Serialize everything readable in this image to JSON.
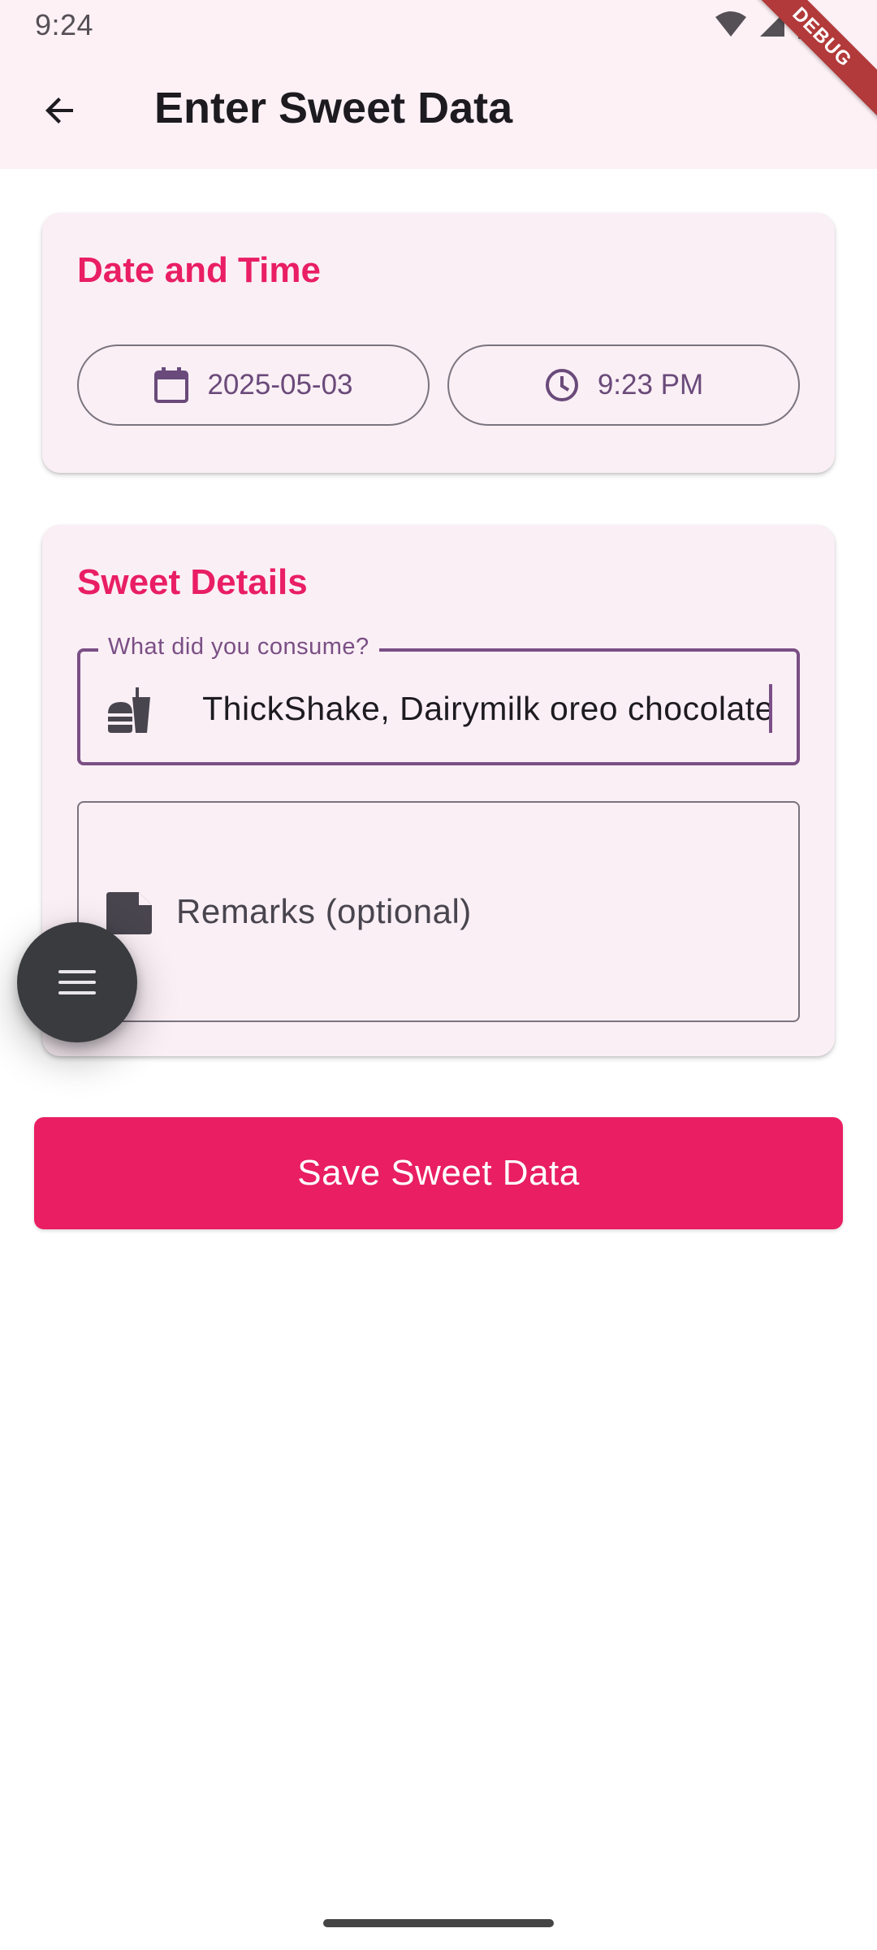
{
  "status_bar": {
    "time": "9:24",
    "icons": [
      "wifi-icon",
      "signal-icon",
      "battery-icon"
    ],
    "debug_banner": "DEBUG"
  },
  "app_bar": {
    "title": "Enter Sweet Data",
    "back_icon": "arrow-back-icon"
  },
  "date_time_card": {
    "title": "Date and Time",
    "date_value": "2025-05-03",
    "date_icon": "calendar-icon",
    "time_value": "9:23 PM",
    "time_icon": "clock-icon"
  },
  "sweet_details_card": {
    "title": "Sweet Details",
    "consume_field": {
      "label": "What did you consume?",
      "value": "ThickShake, Dairymilk oreo chocolate",
      "icon": "fastfood-icon"
    },
    "remarks_field": {
      "placeholder": "Remarks (optional)",
      "icon": "note-icon"
    }
  },
  "fab": {
    "icon": "menu-icon"
  },
  "save_button": {
    "label": "Save Sweet Data"
  },
  "colors": {
    "accent": "#e91e63",
    "header_bg": "#fdf1f6",
    "card_bg": "#faeff5",
    "outline_focus": "#7a4f85"
  }
}
